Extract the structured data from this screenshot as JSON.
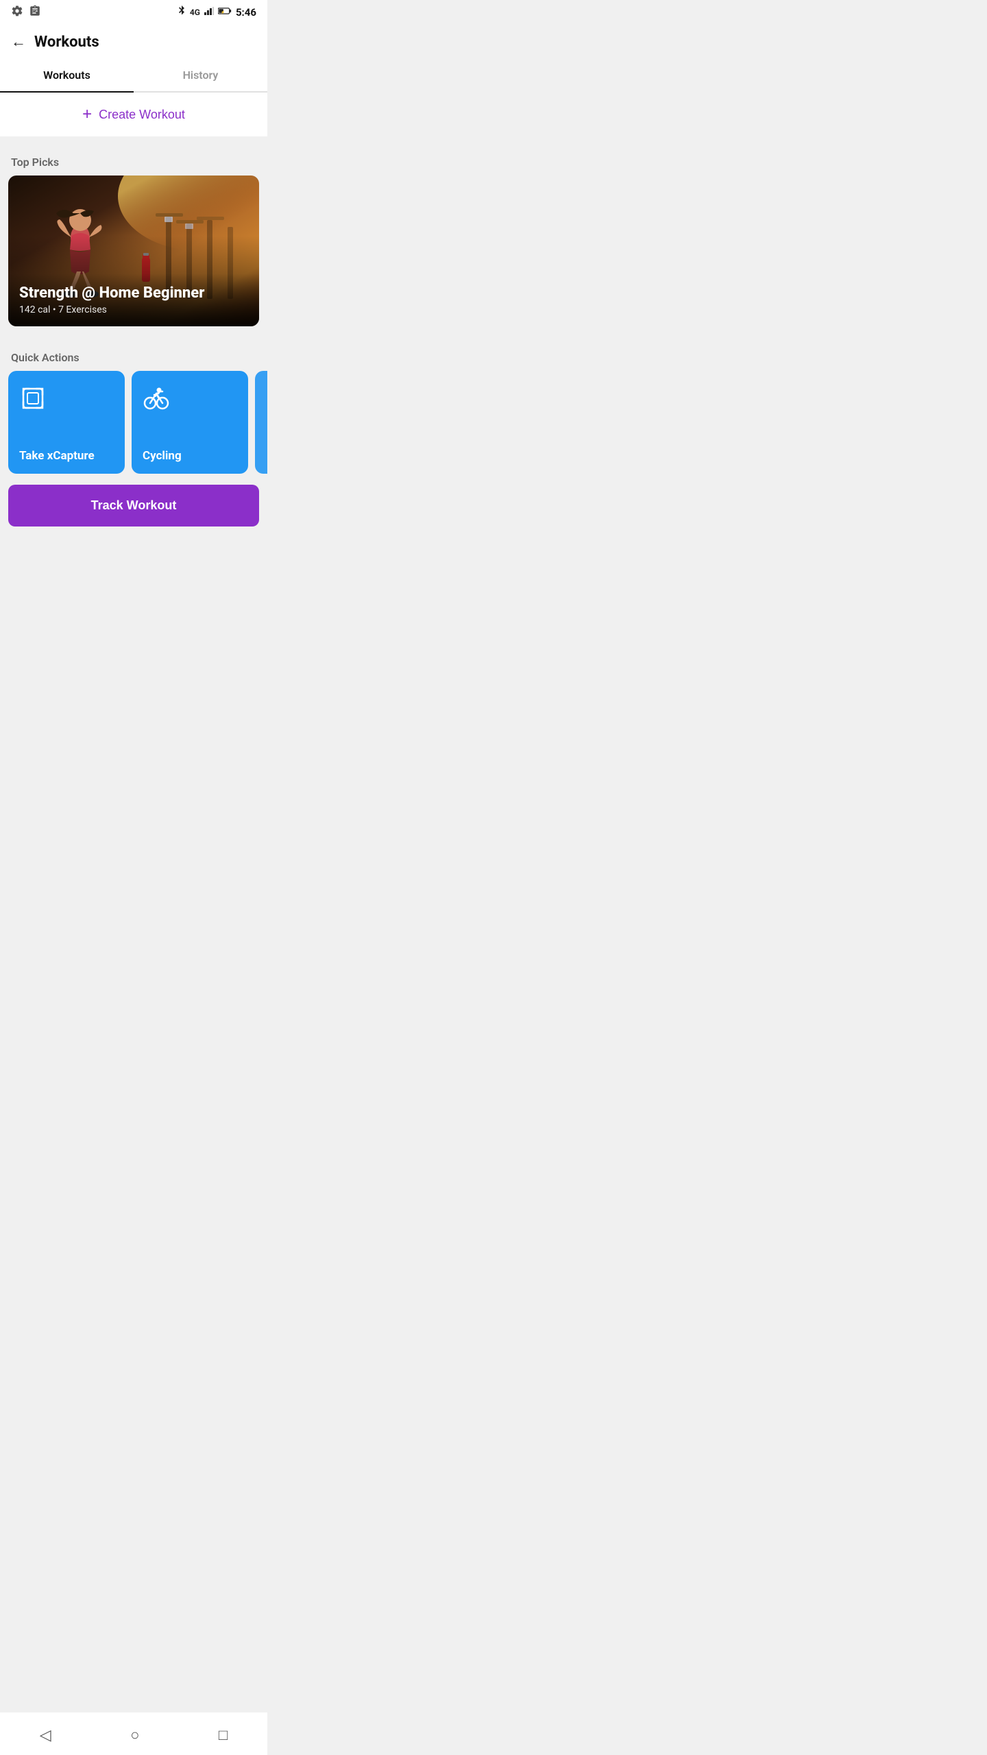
{
  "statusBar": {
    "time": "5:46",
    "icons": {
      "bluetooth": "BT",
      "signal": "4G",
      "battery": "⚡"
    }
  },
  "topNav": {
    "backLabel": "←",
    "title": "Workouts"
  },
  "tabs": [
    {
      "id": "workouts",
      "label": "Workouts",
      "active": true
    },
    {
      "id": "history",
      "label": "History",
      "active": false
    }
  ],
  "createWorkout": {
    "plusIcon": "+",
    "label": "Create Workout"
  },
  "topPicks": {
    "sectionLabel": "Top Picks",
    "card": {
      "title": "Strength @ Home Beginner",
      "meta": "142 cal • 7 Exercises"
    }
  },
  "quickActions": {
    "sectionLabel": "Quick Actions",
    "items": [
      {
        "id": "xcapture",
        "label": "Take xCapture",
        "iconType": "xcapture"
      },
      {
        "id": "cycling",
        "label": "Cycling",
        "iconType": "cycling"
      }
    ]
  },
  "trackWorkout": {
    "label": "Track Workout"
  },
  "bottomNav": {
    "items": [
      {
        "id": "back",
        "icon": "◁"
      },
      {
        "id": "home",
        "icon": "○"
      },
      {
        "id": "recent",
        "icon": "□"
      }
    ]
  },
  "colors": {
    "accent": "#8B2FC9",
    "blue": "#2196F3",
    "tabActive": "#111",
    "tabInactive": "#999",
    "sectionLabel": "#666",
    "background": "#f0f0f0"
  }
}
